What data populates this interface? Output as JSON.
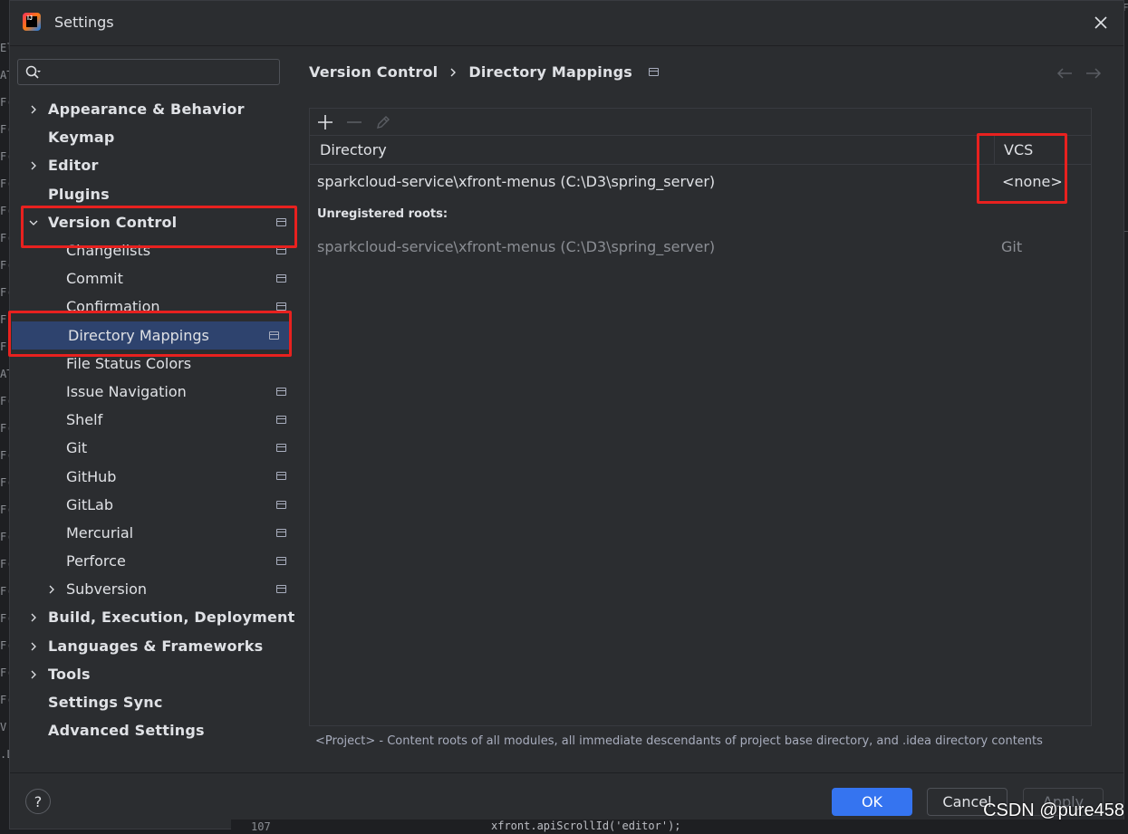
{
  "window": {
    "title": "Settings"
  },
  "search": {
    "placeholder": ""
  },
  "sidebar": {
    "items": [
      {
        "label": "Appearance & Behavior",
        "level": 0,
        "expandable": true,
        "expanded": false,
        "project": false
      },
      {
        "label": "Keymap",
        "level": 0,
        "expandable": false,
        "project": false
      },
      {
        "label": "Editor",
        "level": 0,
        "expandable": true,
        "expanded": false,
        "project": false
      },
      {
        "label": "Plugins",
        "level": 0,
        "expandable": false,
        "project": false
      },
      {
        "label": "Version Control",
        "level": 0,
        "expandable": true,
        "expanded": true,
        "project": true
      },
      {
        "label": "Changelists",
        "level": 1,
        "expandable": false,
        "project": true
      },
      {
        "label": "Commit",
        "level": 1,
        "expandable": false,
        "project": true
      },
      {
        "label": "Confirmation",
        "level": 1,
        "expandable": false,
        "project": true
      },
      {
        "label": "Directory Mappings",
        "level": 1,
        "expandable": false,
        "project": true,
        "selected": true
      },
      {
        "label": "File Status Colors",
        "level": 1,
        "expandable": false,
        "project": false
      },
      {
        "label": "Issue Navigation",
        "level": 1,
        "expandable": false,
        "project": true
      },
      {
        "label": "Shelf",
        "level": 1,
        "expandable": false,
        "project": true
      },
      {
        "label": "Git",
        "level": 1,
        "expandable": false,
        "project": true
      },
      {
        "label": "GitHub",
        "level": 1,
        "expandable": false,
        "project": true
      },
      {
        "label": "GitLab",
        "level": 1,
        "expandable": false,
        "project": true
      },
      {
        "label": "Mercurial",
        "level": 1,
        "expandable": false,
        "project": true
      },
      {
        "label": "Perforce",
        "level": 1,
        "expandable": false,
        "project": true
      },
      {
        "label": "Subversion",
        "level": 1,
        "expandable": true,
        "expanded": false,
        "project": true
      },
      {
        "label": "Build, Execution, Deployment",
        "level": 0,
        "expandable": true,
        "expanded": false,
        "project": false
      },
      {
        "label": "Languages & Frameworks",
        "level": 0,
        "expandable": true,
        "expanded": false,
        "project": false
      },
      {
        "label": "Tools",
        "level": 0,
        "expandable": true,
        "expanded": false,
        "project": false
      },
      {
        "label": "Settings Sync",
        "level": 0,
        "expandable": false,
        "project": false
      },
      {
        "label": "Advanced Settings",
        "level": 0,
        "expandable": false,
        "project": false
      }
    ]
  },
  "breadcrumb": {
    "parent": "Version Control",
    "current": "Directory Mappings"
  },
  "table": {
    "col_directory": "Directory",
    "col_vcs": "VCS",
    "rows": [
      {
        "directory": "sparkcloud-service\\xfront-menus (C:\\D3\\spring_server)",
        "vcs": "<none>"
      }
    ],
    "unregistered_label": "Unregistered roots:",
    "unregistered_rows": [
      {
        "directory": "sparkcloud-service\\xfront-menus (C:\\D3\\spring_server)",
        "vcs": "Git"
      }
    ]
  },
  "footnote": "<Project> - Content roots of all modules, all immediate descendants of project base directory, and .idea directory contents",
  "footer": {
    "help": "?",
    "ok": "OK",
    "cancel": "Cancel",
    "apply": "Apply"
  },
  "background": {
    "line_number": "107",
    "code": "xfront.apiScrollId('editor');",
    "left_glyphs": [
      "El",
      "AT",
      "F(",
      "F(",
      "F(",
      "F(",
      "F(",
      "F(",
      "F(",
      "F(",
      "F(",
      "F(",
      "AT",
      "F(",
      "F(",
      "F(",
      "F(",
      "F(",
      "F(",
      "F(",
      "F(",
      "F(",
      "F(",
      "F(",
      "F(",
      "V",
      ".L"
    ],
    "right_glyphs": [
      "Fr",
      "_s"
    ]
  },
  "watermark": "CSDN @pure458",
  "colors": {
    "dialog_bg": "#2b2d30",
    "selection": "#2e436e",
    "primary_button": "#3574f0",
    "highlight_annotation": "#e8211f"
  }
}
